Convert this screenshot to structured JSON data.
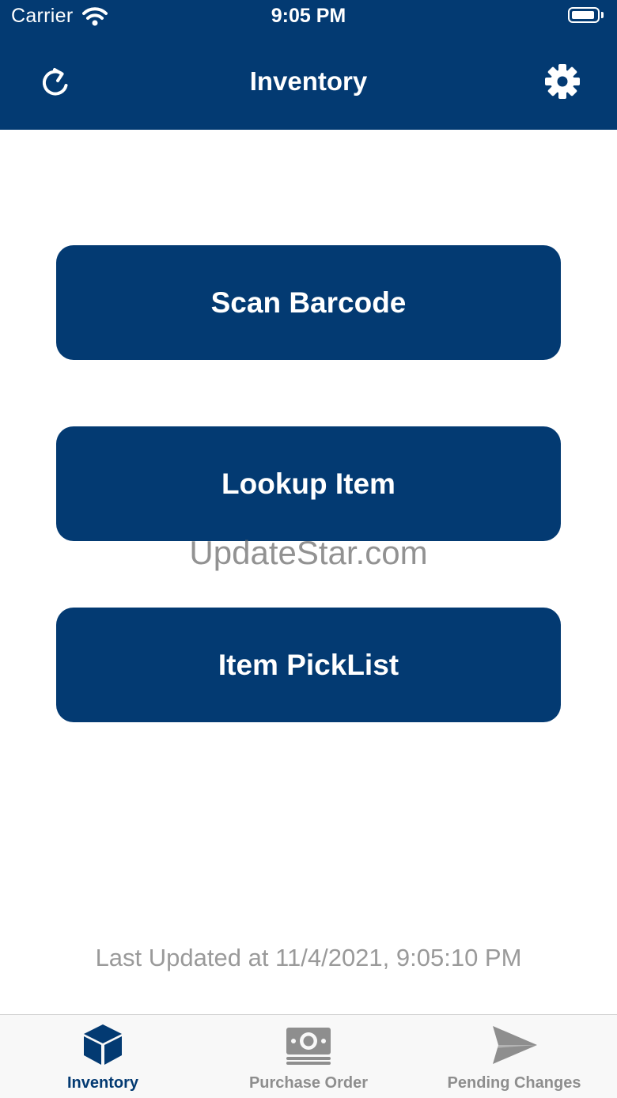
{
  "status_bar": {
    "carrier": "Carrier",
    "time": "9:05 PM"
  },
  "nav": {
    "title": "Inventory",
    "left_icon": "refresh-icon",
    "right_icon": "gear-icon"
  },
  "actions": [
    {
      "label": "Scan Barcode"
    },
    {
      "label": "Lookup Item"
    },
    {
      "label": "Item PickList"
    }
  ],
  "watermark": "UpdateStar.com",
  "last_updated": "Last Updated at 11/4/2021, 9:05:10 PM",
  "tabs": [
    {
      "label": "Inventory",
      "icon": "box-icon",
      "active": true
    },
    {
      "label": "Purchase Order",
      "icon": "money-icon",
      "active": false
    },
    {
      "label": "Pending Changes",
      "icon": "send-icon",
      "active": false
    }
  ],
  "colors": {
    "primary": "#033a72",
    "inactive": "#8e8e8e",
    "secondary_text": "#9a9a9a"
  }
}
